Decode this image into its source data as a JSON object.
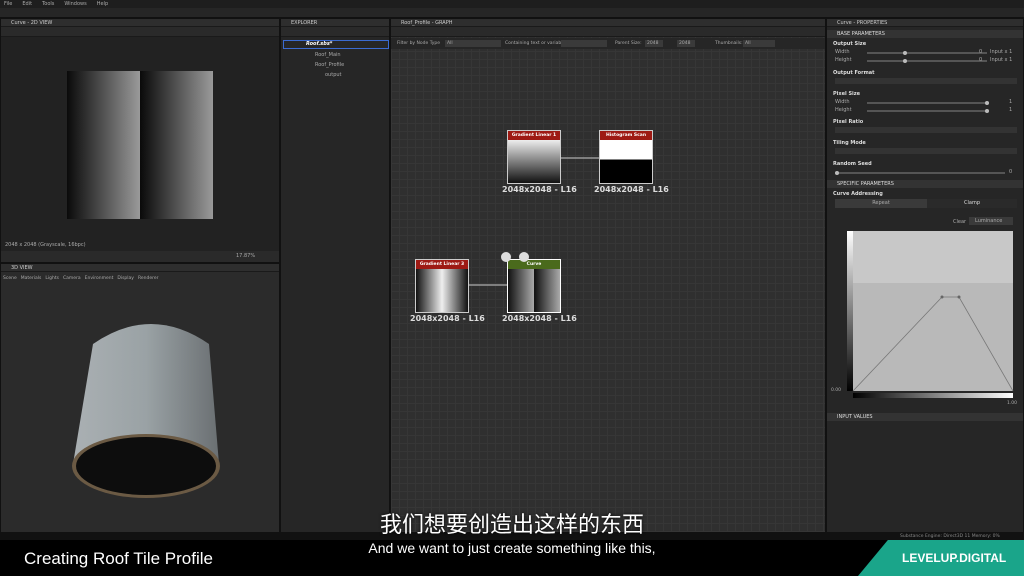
{
  "menu": [
    "File",
    "Edit",
    "Tools",
    "Windows",
    "Help"
  ],
  "view2d": {
    "title": "Curve - 2D VIEW",
    "status": "2048 x 2048 (Grayscale, 16bpc)",
    "zoom": "17.87%"
  },
  "view3d": {
    "title": "3D VIEW",
    "menu": [
      "Scene",
      "Materials",
      "Lights",
      "Camera",
      "Environment",
      "Display",
      "Renderer"
    ]
  },
  "explorer": {
    "title": "EXPLORER",
    "items": [
      "Roof.sbs*",
      "Roof_Main",
      "Roof_Profile",
      "output"
    ]
  },
  "graph": {
    "title": "Roof_Profile - GRAPH",
    "filter_label": "Filter by Node Type",
    "filter_value": "All",
    "contain_label": "Containing text or variable",
    "parent_label": "Parent Size:",
    "parent_value": "2048",
    "size_value": "2048",
    "thumb_label": "Thumbnails:",
    "thumb_value": "All",
    "nodes": [
      {
        "title": "Gradient Linear 1",
        "label": "2048x2048 - L16"
      },
      {
        "title": "Histogram Scan",
        "label": "2048x2048 - L16"
      },
      {
        "title": "Gradient Linear 3",
        "label": "2048x2048 - L16"
      },
      {
        "title": "Curve",
        "label": "2048x2048 - L16"
      }
    ]
  },
  "props": {
    "title": "Curve - PROPERTIES",
    "base": "BASE PARAMETERS",
    "output_size": "Output Size",
    "width": "Width",
    "height": "Height",
    "output_format": "Output Format",
    "pixel_size": "Pixel Size",
    "pixel_ratio": "Pixel Ratio",
    "tiling_mode": "Tiling Mode",
    "random_seed": "Random Seed",
    "specific": "SPECIFIC PARAMETERS",
    "curve_addressing": "Curve Addressing",
    "repeat": "Repeat",
    "clamp": "Clamp",
    "clear": "Clear",
    "luminance": "Luminance",
    "input_values": "INPUT VALUES",
    "axis_min": "0.00",
    "axis_max": "1.00",
    "input_x1": "Input x 1",
    "input_x1b": "Input x 1",
    "zero": "0",
    "one": "1"
  },
  "statusbar": "Substance Engine: Direct3D 11   Memory: 0%",
  "subtitle": {
    "cn": "我们想要创造出这样的东西",
    "en": "And we want to just create something like this,"
  },
  "footer": {
    "title": "Creating Roof Tile Profile",
    "brand": "LEVELUP.DIGITAL"
  }
}
